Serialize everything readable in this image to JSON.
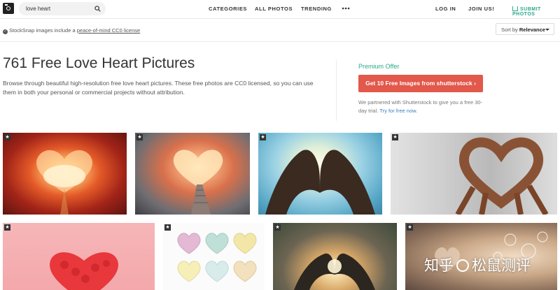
{
  "header": {
    "logo_icon": "camera-logo-icon",
    "search": {
      "value": "love heart",
      "icon": "search-icon"
    },
    "nav": [
      "CATEGORIES",
      "ALL PHOTOS",
      "TRENDING"
    ],
    "more_icon": "ellipsis-icon",
    "login": "LOG IN",
    "join": "JOIN US!",
    "submit": "SUBMIT PHOTOS",
    "accent": "#2aa88a"
  },
  "license_bar": {
    "prefix": "StockSnap images include a",
    "link": "peace-of-mind CC0 license",
    "sort_label": "Sort by",
    "sort_value": "Relevance"
  },
  "main": {
    "title": "761 Free Love Heart Pictures",
    "description": "Browse through beautiful high-resolution free love heart pictures. These free photos are CC0 licensed, so you can use them in both your personal or commercial projects without attribution."
  },
  "premium": {
    "label": "Premium Offer",
    "button": "Get 10 Free Images from shutterstock",
    "partner_text": "We partnered with Shutterstock to give you a free 30-day trial.",
    "partner_link": "Try for free now.",
    "button_color": "#e2584a"
  },
  "photos": [
    "heart-shaped clouds sunset",
    "staircase to heart in sky",
    "hands forming heart against sky",
    "many hands forming heart",
    "red rose petal heart on pink",
    "pastel candy hearts",
    "hands heart at sunset",
    "bokeh hearts"
  ],
  "watermark": {
    "prefix": "知乎",
    "handle": "松鼠测评"
  }
}
